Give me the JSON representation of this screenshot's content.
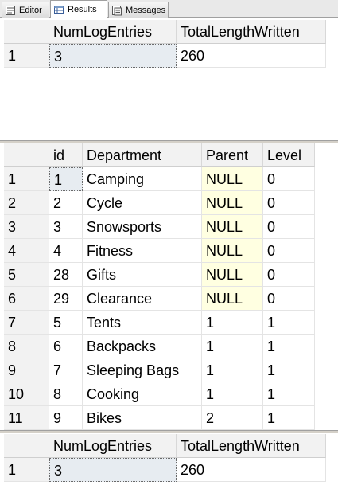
{
  "tabs": [
    {
      "label": "Editor",
      "icon": "editor-icon",
      "active": false
    },
    {
      "label": "Results",
      "icon": "grid-icon",
      "active": true
    },
    {
      "label": "Messages",
      "icon": "messages-icon",
      "active": false
    }
  ],
  "result1": {
    "columns": [
      "NumLogEntries",
      "TotalLengthWritten"
    ],
    "rows": [
      {
        "num": "1",
        "cells": [
          "3",
          "260"
        ]
      }
    ]
  },
  "result2": {
    "columns": [
      "id",
      "Department",
      "Parent",
      "Level"
    ],
    "rows": [
      {
        "num": "1",
        "cells": [
          "1",
          "Camping",
          "NULL",
          "0"
        ]
      },
      {
        "num": "2",
        "cells": [
          "2",
          "Cycle",
          "NULL",
          "0"
        ]
      },
      {
        "num": "3",
        "cells": [
          "3",
          "Snowsports",
          "NULL",
          "0"
        ]
      },
      {
        "num": "4",
        "cells": [
          "4",
          "Fitness",
          "NULL",
          "0"
        ]
      },
      {
        "num": "5",
        "cells": [
          "28",
          "Gifts",
          "NULL",
          "0"
        ]
      },
      {
        "num": "6",
        "cells": [
          "29",
          "Clearance",
          "NULL",
          "0"
        ]
      },
      {
        "num": "7",
        "cells": [
          "5",
          "Tents",
          "1",
          "1"
        ]
      },
      {
        "num": "8",
        "cells": [
          "6",
          "Backpacks",
          "1",
          "1"
        ]
      },
      {
        "num": "9",
        "cells": [
          "7",
          "Sleeping Bags",
          "1",
          "1"
        ]
      },
      {
        "num": "10",
        "cells": [
          "8",
          "Cooking",
          "1",
          "1"
        ]
      },
      {
        "num": "11",
        "cells": [
          "9",
          "Bikes",
          "2",
          "1"
        ]
      }
    ]
  },
  "result3": {
    "columns": [
      "NumLogEntries",
      "TotalLengthWritten"
    ],
    "rows": [
      {
        "num": "1",
        "cells": [
          "3",
          "260"
        ]
      }
    ]
  },
  "colors": {
    "null_highlight": "#ffffe1",
    "selected_cell": "#e7ecf1",
    "header_bg": "#f2f2f2"
  }
}
